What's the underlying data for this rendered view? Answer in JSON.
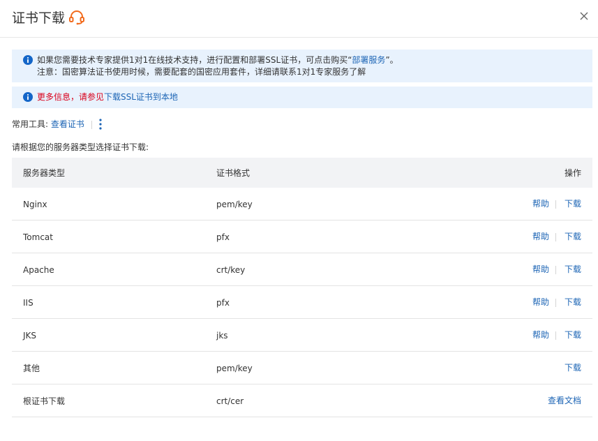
{
  "dialog": {
    "title": "证书下载"
  },
  "notices": {
    "line1_prefix": "如果您需要技术专家提供1对1在线技术支持，进行配置和部署SSL证书，可点击购买“",
    "line1_link": "部署服务",
    "line1_suffix": "”。",
    "line2": "注意：国密算法证书使用时候，需要配套的国密应用套件，详细请联系1对1专家服务了解",
    "more_info_red": "更多信息，请参见",
    "more_info_link": "下载SSL证书到本地"
  },
  "tools": {
    "label": "常用工具:",
    "view_cert": "查看证书"
  },
  "prompt": "请根据您的服务器类型选择证书下载:",
  "table": {
    "headers": {
      "server_type": "服务器类型",
      "cert_format": "证书格式",
      "actions": "操作"
    },
    "rows": [
      {
        "server": "Nginx",
        "format": "pem/key",
        "help": "帮助",
        "download": "下载"
      },
      {
        "server": "Tomcat",
        "format": "pfx",
        "help": "帮助",
        "download": "下载"
      },
      {
        "server": "Apache",
        "format": "crt/key",
        "help": "帮助",
        "download": "下载"
      },
      {
        "server": "IIS",
        "format": "pfx",
        "help": "帮助",
        "download": "下载"
      },
      {
        "server": "JKS",
        "format": "jks",
        "help": "帮助",
        "download": "下载"
      },
      {
        "server": "其他",
        "format": "pem/key",
        "download": "下载"
      },
      {
        "server": "根证书下载",
        "format": "crt/cer",
        "view_docs": "查看文档"
      }
    ]
  },
  "icons": {
    "headset": "headset-icon",
    "close": "close-icon",
    "info": "info-icon",
    "more": "more-vertical-icon"
  },
  "colors": {
    "link": "#1d65b5",
    "notice_bg": "#e8f2fd",
    "warning_red": "#d9001b",
    "headset_orange": "#f26b1d",
    "info_blue": "#1466c8"
  }
}
